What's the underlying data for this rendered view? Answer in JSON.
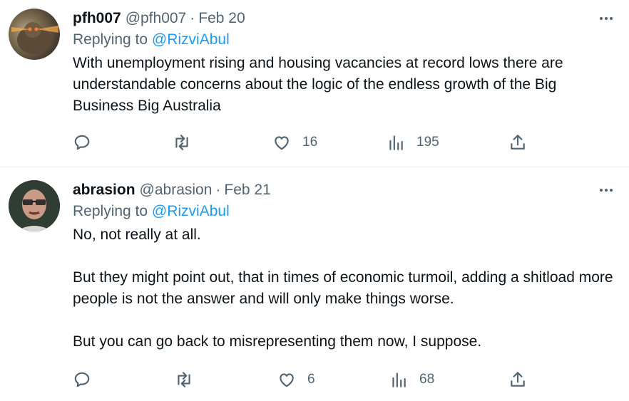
{
  "tweets": [
    {
      "name": "pfh007",
      "handle": "@pfh007",
      "dot": "·",
      "date": "Feb 20",
      "replying_prefix": "Replying to ",
      "replying_to": "@RizviAbul",
      "text": "With unemployment rising and housing vacancies at record lows there are understandable concerns about the logic of the endless growth of the Big Business Big Australia",
      "likes": "16",
      "views": "195"
    },
    {
      "name": "abrasion",
      "handle": "@abrasion",
      "dot": "·",
      "date": "Feb 21",
      "replying_prefix": "Replying to ",
      "replying_to": "@RizviAbul",
      "text": "No, not really at all.\n\nBut they might point out, that in times of economic turmoil, adding a shitload more people is not the answer and will only make things worse.\n\nBut you can go back to misrepresenting them now, I suppose.",
      "likes": "6",
      "views": "68"
    }
  ],
  "icons": {
    "reply": "reply-icon",
    "retweet": "retweet-icon",
    "like": "heart-icon",
    "views": "views-icon",
    "share": "share-icon",
    "more": "more-icon"
  },
  "colors": {
    "link": "#1d9bf0",
    "muted": "#536471",
    "text": "#0f1419"
  }
}
